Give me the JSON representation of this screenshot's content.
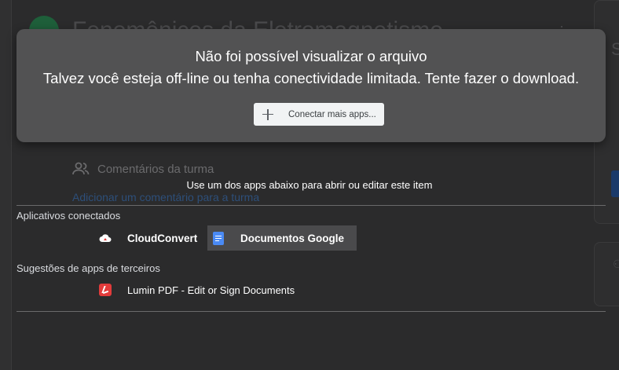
{
  "background": {
    "course_title": "Fenomênicos da Eletromagnetismo",
    "comments_heading": "Comentários da turma",
    "add_comment_link": "Adicionar um comentário para a turma",
    "right_panel_letter": "S"
  },
  "error_card": {
    "title": "Não foi possível visualizar o arquivo",
    "message": "Talvez você esteja off-line ou tenha conectividade limitada. Tente fazer o download.",
    "connect_button_label": "Conectar mais apps..."
  },
  "apps_panel": {
    "instruction": "Use um dos apps abaixo para abrir ou editar este item",
    "connected_label": "Aplicativos conectados",
    "connected_apps": [
      {
        "name": "CloudConvert",
        "icon": "cloudconvert-icon",
        "selected": false
      },
      {
        "name": "Documentos Google",
        "icon": "google-docs-icon",
        "selected": true
      }
    ],
    "suggestions_label": "Sugestões de apps de terceiros",
    "suggested_apps": [
      {
        "name": "Lumin PDF - Edit or Sign Documents",
        "icon": "lumin-pdf-icon"
      }
    ]
  },
  "colors": {
    "overlay_bg": "#2b2b2c",
    "error_card_bg": "#525253",
    "docs_blue": "#4a8af4",
    "lumin_red": "#e23b3b"
  }
}
